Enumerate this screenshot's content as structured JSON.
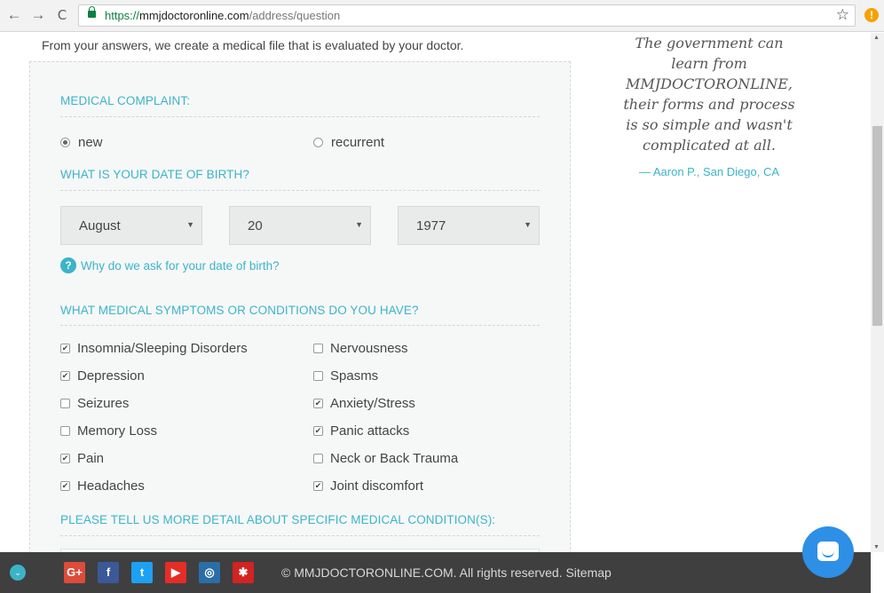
{
  "browser": {
    "url_scheme": "https://",
    "url_host": "mmjdoctoronline.com",
    "url_path": "/address/question",
    "nav_back": "←",
    "nav_forward": "→",
    "nav_reload": "C",
    "star": "☆",
    "extension_badge": "!"
  },
  "page": {
    "intro": "From your answers, we create a medical file that is evaluated by your doctor."
  },
  "form": {
    "complaint_title": "MEDICAL COMPLAINT:",
    "complaint_options": [
      {
        "label": "new",
        "selected": true
      },
      {
        "label": "recurrent",
        "selected": false
      }
    ],
    "dob_title": "WHAT IS YOUR DATE OF BIRTH?",
    "dob": {
      "month": "August",
      "day": "20",
      "year": "1977"
    },
    "caret": "▼",
    "why_dob": "Why do we ask for your date of birth?",
    "why_icon": "?",
    "symptoms_title": "WHAT MEDICAL SYMPTOMS OR CONDITIONS DO YOU HAVE?",
    "symptoms_left": [
      {
        "label": "Insomnia/Sleeping Disorders",
        "checked": true
      },
      {
        "label": "Depression",
        "checked": true
      },
      {
        "label": "Seizures",
        "checked": false
      },
      {
        "label": "Memory Loss",
        "checked": false
      },
      {
        "label": "Pain",
        "checked": true
      },
      {
        "label": "Headaches",
        "checked": true
      }
    ],
    "symptoms_right": [
      {
        "label": "Nervousness",
        "checked": false
      },
      {
        "label": "Spasms",
        "checked": false
      },
      {
        "label": "Anxiety/Stress",
        "checked": true
      },
      {
        "label": "Panic attacks",
        "checked": true
      },
      {
        "label": "Neck or Back Trauma",
        "checked": false
      },
      {
        "label": "Joint discomfort",
        "checked": true
      }
    ],
    "detail_title": "PLEASE TELL US MORE DETAIL ABOUT SPECIFIC MEDICAL CONDITION(S):"
  },
  "testimonial": {
    "lines": [
      "The government can",
      "learn from",
      "MMJDOCTORONLINE,",
      "their forms and process",
      "is so simple and wasn't",
      "complicated at all."
    ],
    "author": "— Aaron P., San Diego, CA"
  },
  "footer": {
    "toggle": "⌄",
    "social": [
      {
        "name": "google-plus",
        "label": "G+",
        "color": "#dd4b39"
      },
      {
        "name": "facebook",
        "label": "f",
        "color": "#3b5998"
      },
      {
        "name": "twitter",
        "label": "t",
        "color": "#1da1f2"
      },
      {
        "name": "youtube",
        "label": "▶",
        "color": "#e52d27"
      },
      {
        "name": "instagram",
        "label": "◎",
        "color": "#2a6ea8"
      },
      {
        "name": "yelp",
        "label": "✱",
        "color": "#d32323"
      }
    ],
    "copyright": "© MMJDOCTORONLINE.COM. All rights reserved.",
    "sitemap": "Sitemap"
  },
  "colors": {
    "accent": "#3cb4c8",
    "footer_bg": "#3f3f3f",
    "chat": "#2d8fe6"
  }
}
